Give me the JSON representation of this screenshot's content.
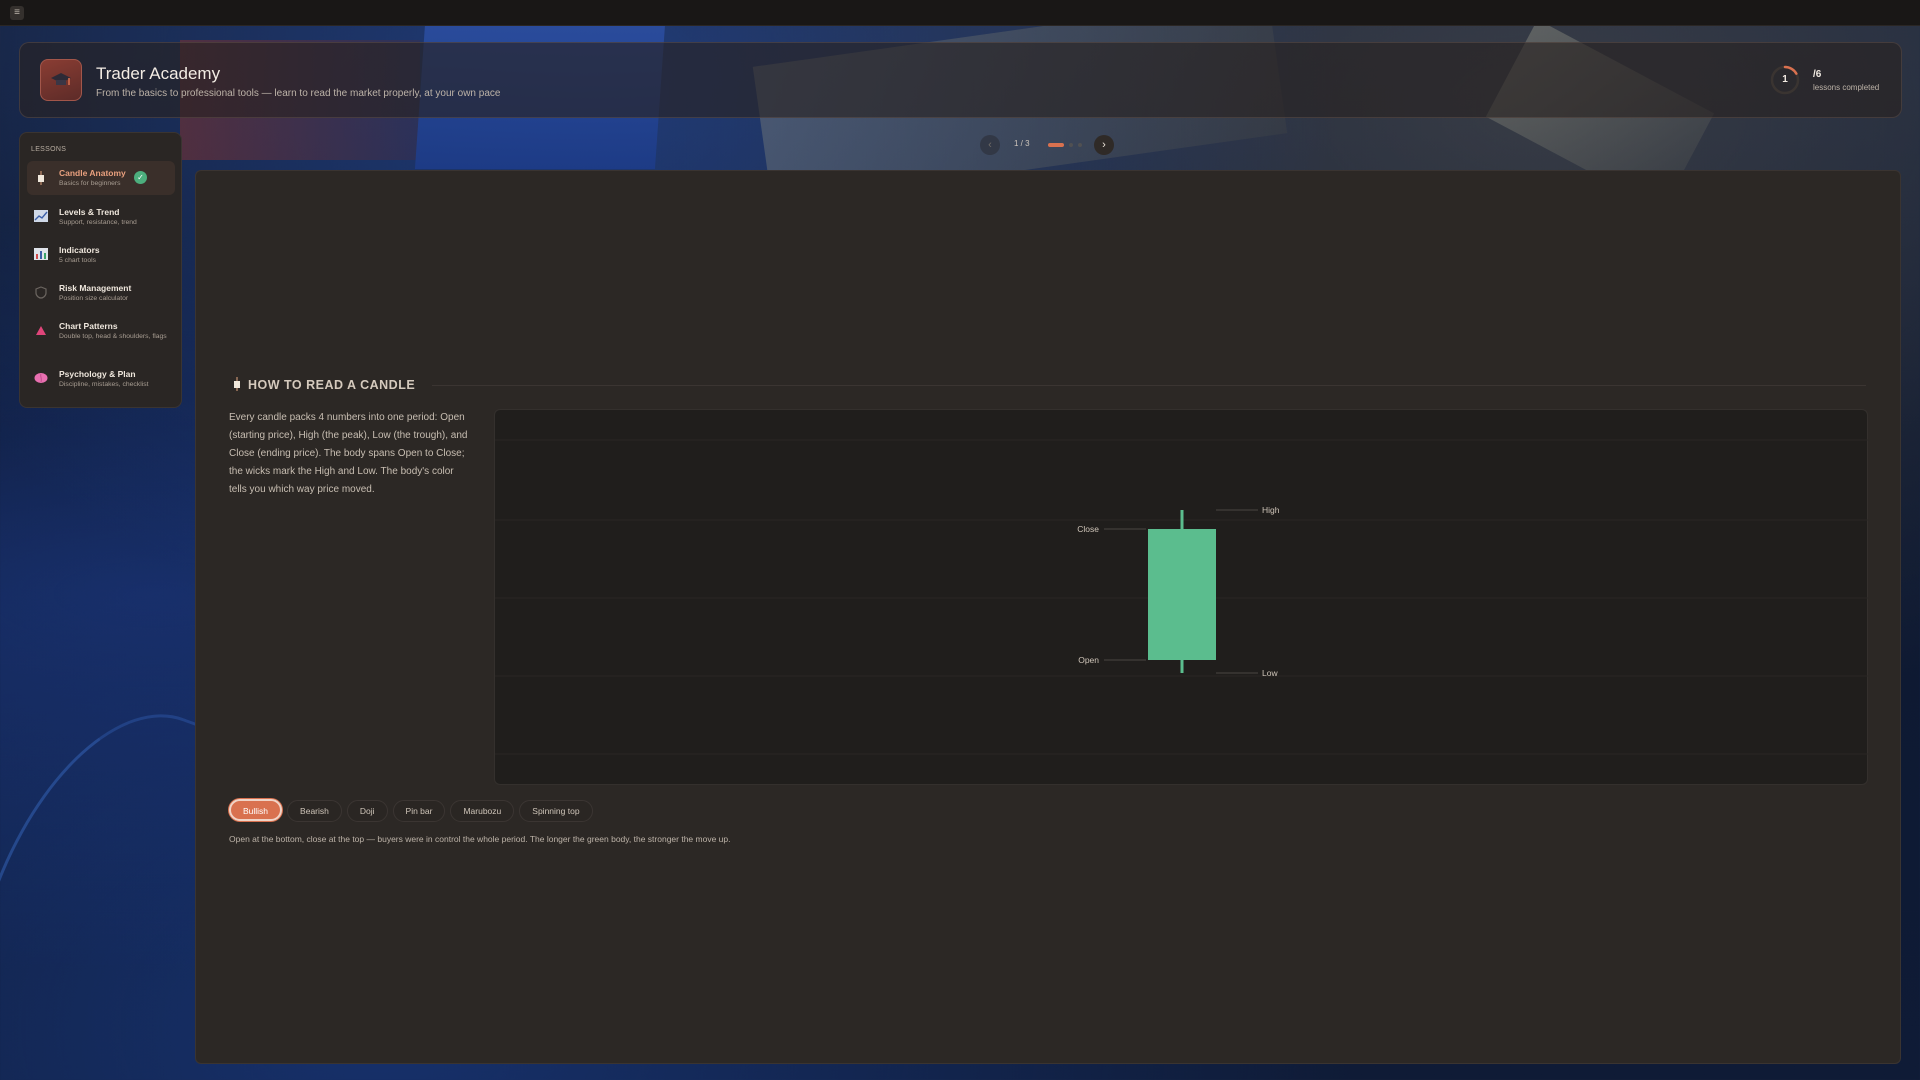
{
  "app": {
    "title": "Trader Academy",
    "subtitle": "From the basics to professional tools — learn to read the market properly, at your own pace"
  },
  "progress": {
    "completed": "1",
    "total": "/6",
    "label": "lessons completed",
    "fraction": 0.1667
  },
  "pager": {
    "count": "1 / 3",
    "current_page": 1,
    "total_pages": 3
  },
  "sidebar": {
    "heading": "LESSONS",
    "items": [
      {
        "title": "Candle Anatomy",
        "subtitle": "Basics for beginners",
        "icon": "candle-icon",
        "active": true,
        "completed": true
      },
      {
        "title": "Levels & Trend",
        "subtitle": "Support, resistance, trend",
        "icon": "trend-chart-icon",
        "active": false,
        "completed": false
      },
      {
        "title": "Indicators",
        "subtitle": "5 chart tools",
        "icon": "bar-chart-icon",
        "active": false,
        "completed": false
      },
      {
        "title": "Risk Management",
        "subtitle": "Position size calculator",
        "icon": "shield-icon",
        "active": false,
        "completed": false
      },
      {
        "title": "Chart Patterns",
        "subtitle": "Double top, head & shoulders, flags",
        "icon": "triangle-icon",
        "active": false,
        "completed": false
      },
      {
        "title": "Psychology & Plan",
        "subtitle": "Discipline, mistakes, checklist",
        "icon": "brain-icon",
        "active": false,
        "completed": false
      }
    ]
  },
  "section": {
    "title": "HOW TO READ A CANDLE",
    "description": "Every candle packs 4 numbers into one period: Open (starting price), High (the peak), Low (the trough), and Close (ending price). The body spans Open to Close; the wicks mark the High and Low. The body's color tells you which way price moved."
  },
  "candle": {
    "labels": {
      "high": "High",
      "close": "Close",
      "open": "Open",
      "low": "Low"
    },
    "color": "#5bbd8e"
  },
  "candle_types": {
    "options": [
      "Bullish",
      "Bearish",
      "Doji",
      "Pin bar",
      "Marubozu",
      "Spinning top"
    ],
    "selected": "Bullish",
    "description": "Open at the bottom, close at the top — buyers were in control the whole period. The longer the green body, the stronger the move up."
  },
  "colors": {
    "accent": "#d9714f",
    "success": "#4cae7d",
    "panel": "#2c2825"
  }
}
